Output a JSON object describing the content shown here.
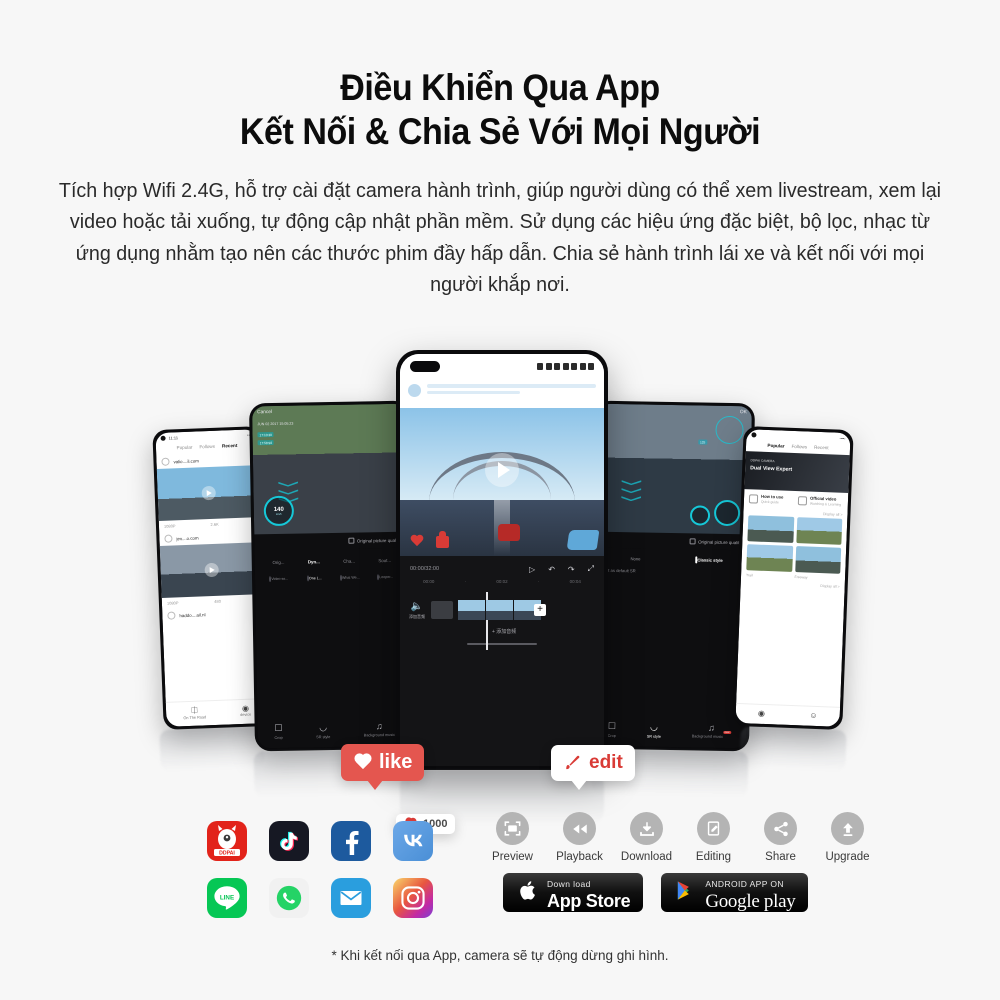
{
  "page": {
    "background_color": "#f7f7f7",
    "heading_color": "#0c0c0c",
    "accent_red": "#d93b36",
    "bubble_red": "#e4564f"
  },
  "heading": {
    "line1": "Điều Khiển Qua App",
    "line2": "Kết Nối & Chia Sẻ Với Mọi Người"
  },
  "lede": "Tích hợp Wifi 2.4G, hỗ trợ cài đặt camera hành trình, giúp người dùng có thể xem livestream, xem lại video hoặc tải xuống, tự động cập nhật phần mềm. Sử dụng các hiệu ứng đặc biệt, bộ lọc, nhạc từ ứng dụng nhằm tạo nên các thước phim đầy hấp dẫn. Chia sẻ hành trình lái xe và kết nối với mọi người khắp nơi.",
  "callouts": {
    "like": {
      "label": "like",
      "icon": "heart-icon"
    },
    "edit": {
      "label": "edit",
      "icon": "brush-icon"
    },
    "likes_count": {
      "label": "1000",
      "icon": "heart-icon"
    }
  },
  "phones": {
    "left_feed": {
      "status_time": "11:11",
      "tabs": [
        "Popular",
        "Follows",
        "Recent"
      ],
      "active_tab": "Recent",
      "posts": [
        {
          "user": "valio....il.com",
          "resolution": "1080P",
          "views": "2.6K",
          "likes": "1"
        },
        {
          "user": "jev....o.com",
          "resolution": "1080P",
          "views": "480",
          "likes": "0"
        },
        {
          "user": "haddo....ail.nl",
          "resolution": "",
          "views": "",
          "likes": ""
        }
      ],
      "nav": [
        "On The Road",
        "device"
      ]
    },
    "editor_filters": {
      "cancel_label": "Cancel",
      "timestamp": "JUN 02 2017 15:05:23",
      "speed_value": "140",
      "speed_unit": "km/h",
      "speed_caption": "SPEED",
      "quality_label": "Original picture quality",
      "filters": [
        "Orig...",
        "Dyn...",
        "Cha...",
        "Soot..."
      ],
      "active_filter": "Dyn...",
      "music": [
        "Video so...",
        "One L...",
        "What We...",
        "Looper..."
      ],
      "active_music": "One L...",
      "nav": [
        "Crop",
        "SR style",
        "Background music"
      ]
    },
    "center_player": {
      "time_code": "00:00/32:00",
      "ruler": [
        "00:00",
        "00:02",
        "00:04"
      ],
      "audio_label": "添加音频",
      "add_audio_label": "+ 添加音频",
      "controls": [
        "play-icon",
        "undo-icon",
        "redo-icon",
        "fullscreen-icon"
      ]
    },
    "editor_sr": {
      "ok_label": "OK",
      "hud_speed": "125",
      "quality_label": "Original picture quality",
      "styles": [
        "None",
        "Classic style"
      ],
      "selected_style": "Classic style",
      "set_default_label": "Set as default SR",
      "nav": [
        "Crop",
        "SR style",
        "Background music"
      ],
      "active_nav": "SR style",
      "nav_badge": "new"
    },
    "right_feed": {
      "tabs": [
        "Popular",
        "Follows",
        "Recent"
      ],
      "active_tab": "Popular",
      "banner_kicker": "DDPAI CAMERA",
      "banner_title": "Dual View Expert",
      "cards": [
        {
          "title": "How to use",
          "subtitle": "Quick guide"
        },
        {
          "title": "Official video",
          "subtitle": "Watching & Learning"
        }
      ],
      "display_all": "Display all >",
      "grid_views": [
        "14700",
        "8206",
        "1103",
        "920"
      ],
      "captions": [
        "Trail",
        "Freeway"
      ],
      "section_label": "...ful moment",
      "nav": [
        "device-icon",
        "profile-icon"
      ]
    }
  },
  "social_icons": [
    {
      "name": "ddpai-icon",
      "label": "DDPAI"
    },
    {
      "name": "tiktok-icon",
      "label": "TikTok"
    },
    {
      "name": "facebook-icon",
      "label": "Facebook"
    },
    {
      "name": "vk-icon",
      "label": "VK"
    },
    {
      "name": "line-icon",
      "label": "LINE"
    },
    {
      "name": "whatsapp-icon",
      "label": "WhatsApp"
    },
    {
      "name": "email-icon",
      "label": "Email"
    },
    {
      "name": "instagram-icon",
      "label": "Instagram"
    }
  ],
  "features": [
    {
      "label": "Preview",
      "icon": "preview-icon"
    },
    {
      "label": "Playback",
      "icon": "rewind-icon"
    },
    {
      "label": "Download",
      "icon": "download-icon"
    },
    {
      "label": "Editing",
      "icon": "edit-document-icon"
    },
    {
      "label": "Share",
      "icon": "share-icon"
    },
    {
      "label": "Upgrade",
      "icon": "upload-arrow-icon"
    }
  ],
  "stores": {
    "apple": {
      "top": "Down load",
      "big": "App Store",
      "icon": "apple-icon"
    },
    "google": {
      "top": "ANDROID APP ON",
      "big": "Google play",
      "icon": "play-triangle-icon"
    }
  },
  "footnote": "* Khi kết nối qua App, camera sẽ tự động dừng ghi hình."
}
